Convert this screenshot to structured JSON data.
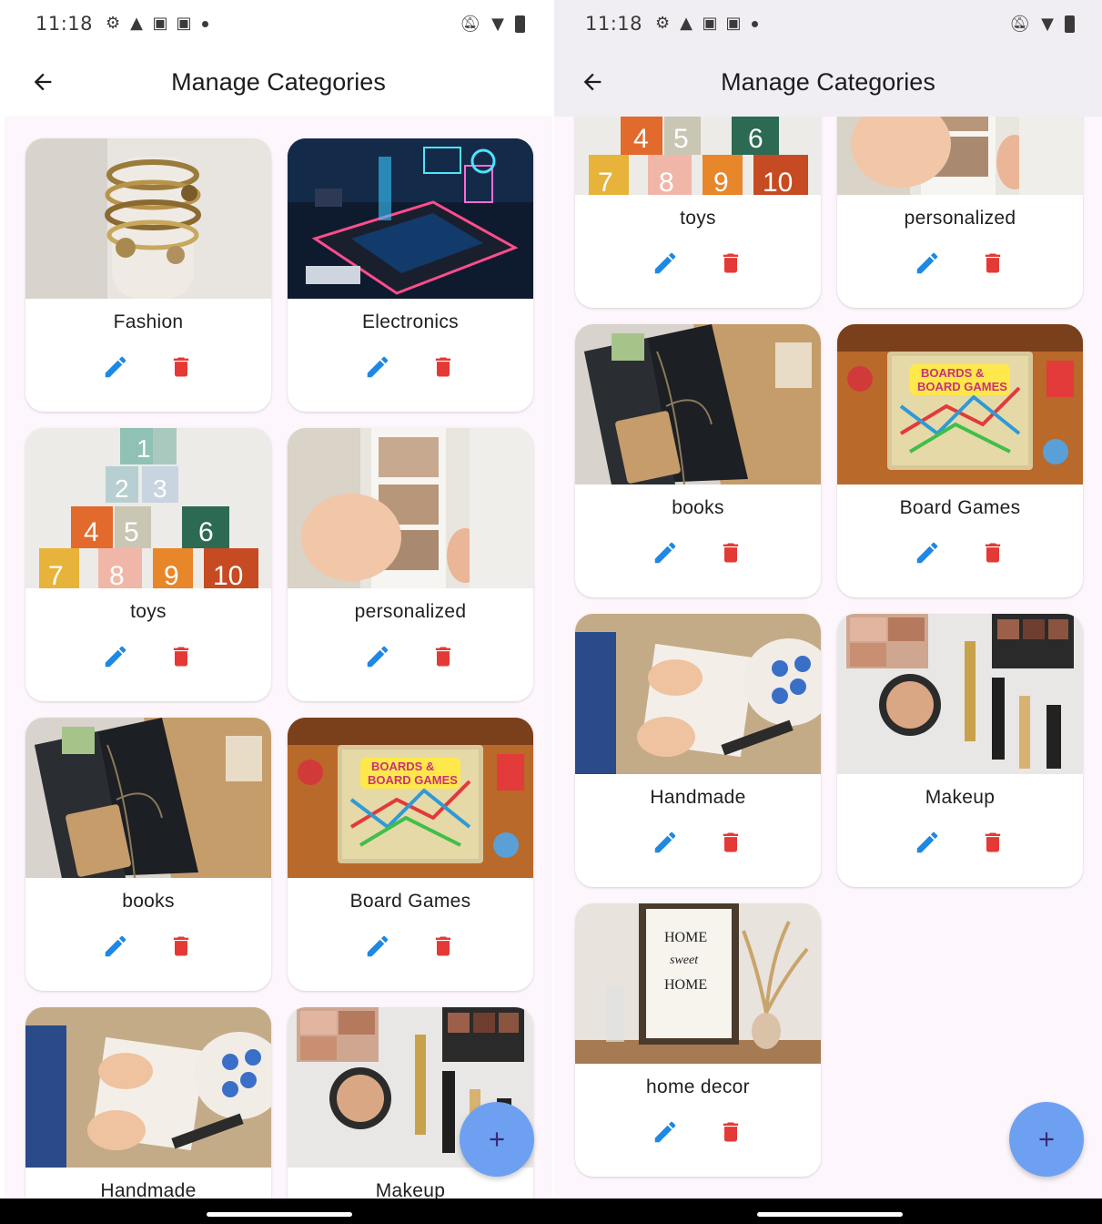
{
  "status_bar": {
    "time": "11:18"
  },
  "app_bar": {
    "title": "Manage Categories"
  },
  "categories": [
    {
      "name": "Fashion"
    },
    {
      "name": "Electronics"
    },
    {
      "name": "toys"
    },
    {
      "name": "personalized"
    },
    {
      "name": "books"
    },
    {
      "name": "Board Games"
    },
    {
      "name": "Handmade"
    },
    {
      "name": "Makeup"
    },
    {
      "name": "home decor"
    }
  ],
  "icons": {
    "back": "arrow-back-icon",
    "edit": "pencil-icon",
    "delete": "trash-icon",
    "fab": "plus-icon"
  },
  "colors": {
    "edit": "#1e88e5",
    "delete": "#e53935",
    "fab": "#6ea0f2",
    "background": "#fdf6fc"
  }
}
